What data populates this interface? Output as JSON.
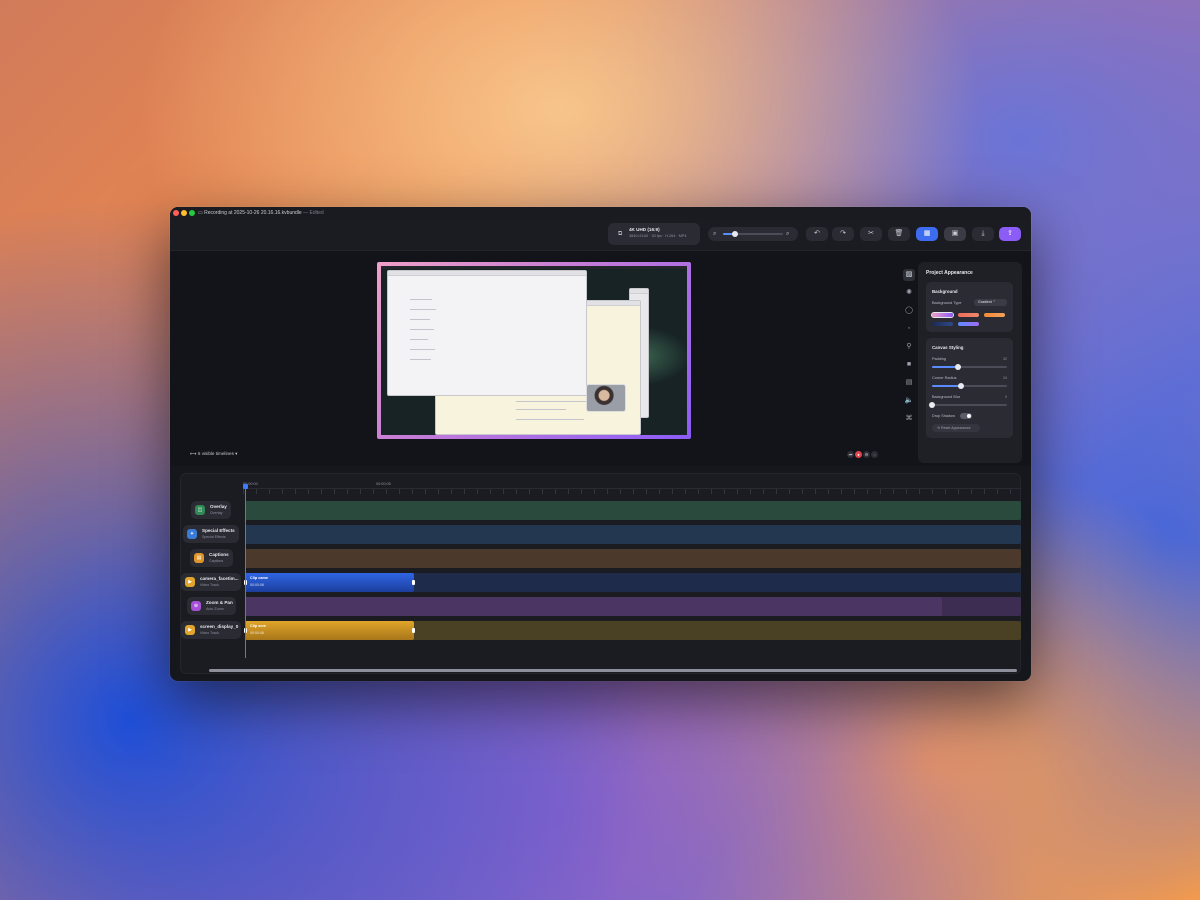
{
  "window": {
    "title": "Recording at 2025-10-26 20.16.16.kvbundle",
    "title_suffix": "— Edited"
  },
  "toolbar": {
    "export_title": "4K UHD (16:9)",
    "export_details": "3840×2160 · 30 fps · H.264 · MP4",
    "zoom_level": 0.2,
    "buttons": [
      "undo-icon",
      "redo-icon",
      "scissors-icon",
      "trash-icon",
      "grid-icon",
      "layout-icon",
      "download-icon",
      "share-icon"
    ]
  },
  "stage": {
    "visible_timelines": "6 visible timelines",
    "playback_buttons": [
      "skip-back-icon",
      "record-icon",
      "settings-icon",
      "more-icon"
    ]
  },
  "side_tabs": [
    "image-icon",
    "sparkle-icon",
    "shape-icon",
    "cursor-icon",
    "link-icon",
    "camera-icon",
    "caption-icon",
    "audio-icon",
    "command-icon"
  ],
  "panel": {
    "title": "Project Appearance",
    "background": {
      "heading": "Background",
      "type_label": "Background Type",
      "type_value": "Gradient",
      "swatches": [
        {
          "name": "pink-purple",
          "color": "linear-gradient(90deg,#f2a0c6,#8b5cf6)",
          "selected": true
        },
        {
          "name": "coral",
          "color": "linear-gradient(90deg,#f06b5b,#ee8a6a)",
          "selected": false
        },
        {
          "name": "orange",
          "color": "linear-gradient(90deg,#f28b38,#f5a05c)",
          "selected": false
        },
        {
          "name": "navy",
          "color": "linear-gradient(90deg,#1c2a52,#2e4a8a)",
          "selected": false
        },
        {
          "name": "blue-violet",
          "color": "linear-gradient(90deg,#5b8cff,#a16bf5)",
          "selected": false
        }
      ]
    },
    "canvas_styling": {
      "heading": "Canvas Styling",
      "padding_label": "Padding",
      "padding_value": "32",
      "padding_level": 0.35,
      "corner_label": "Corner Radius",
      "corner_value": "24",
      "corner_level": 0.39,
      "blur_label": "Background Blur",
      "blur_value": "0",
      "blur_level": 0.0,
      "shadow_label": "Drop Shadow",
      "reset_label": "Reset Appearance"
    }
  },
  "timeline": {
    "ruler": [
      "00:00:00",
      "00:00:05"
    ],
    "tracks": [
      {
        "name": "Overlay",
        "sub": "Overlay",
        "icon": "overlay-icon",
        "icon_color": "#2f8a55",
        "lane_color": "#294a3d"
      },
      {
        "name": "Special Effects",
        "sub": "Special Effects",
        "icon": "sparkle-icon",
        "icon_color": "#3b7ad6",
        "lane_color": "#243750"
      },
      {
        "name": "Captions",
        "sub": "Captions",
        "icon": "caption-icon",
        "icon_color": "#e0952a",
        "lane_color": "#4b3a2c"
      },
      {
        "name": "camera_facetim...",
        "sub": "Video Track",
        "icon": "video-icon",
        "icon_color": "#e0a52a",
        "lane_color": "#1f2b4a",
        "clip": {
          "name": "Clip came",
          "duration": "00:00:06",
          "color": "linear-gradient(180deg,#3066e6,#1c3e9c)"
        }
      },
      {
        "name": "Zoom & Pan",
        "sub": "Auto Zoom",
        "icon": "zoom-icon",
        "icon_color": "#a550d6",
        "lane_color": "#3e2d52"
      },
      {
        "name": "screen_display_0",
        "sub": "Video Track",
        "icon": "video-icon",
        "icon_color": "#e0a52a",
        "lane_color": "#4a4024",
        "clip": {
          "name": "Clip scre",
          "duration": "00:00:06",
          "color": "linear-gradient(180deg,#e0a52a,#a8761a)"
        }
      }
    ]
  }
}
